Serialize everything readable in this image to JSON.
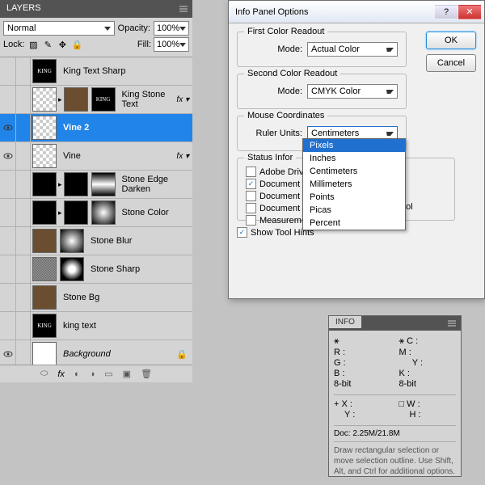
{
  "layers_panel": {
    "title": "LAYERS",
    "blend_mode": "Normal",
    "opacity_label": "Opacity:",
    "opacity_value": "100%",
    "lock_label": "Lock:",
    "fill_label": "Fill:",
    "fill_value": "100%",
    "layers": [
      {
        "name": "King Text Sharp",
        "fx": false,
        "vis": false
      },
      {
        "name": "King Stone Text",
        "fx": true,
        "vis": false
      },
      {
        "name": "Vine 2",
        "fx": false,
        "vis": true,
        "selected": true
      },
      {
        "name": "Vine",
        "fx": true,
        "vis": true
      },
      {
        "name": "Stone Edge Darken",
        "fx": false,
        "vis": false
      },
      {
        "name": "Stone Color",
        "fx": false,
        "vis": false
      },
      {
        "name": "Stone Blur",
        "fx": false,
        "vis": false
      },
      {
        "name": "Stone Sharp",
        "fx": false,
        "vis": false
      },
      {
        "name": "Stone Bg",
        "fx": false,
        "vis": false
      },
      {
        "name": "king text",
        "fx": false,
        "vis": false
      },
      {
        "name": "Background",
        "fx": false,
        "vis": true,
        "locked": true,
        "italic": true
      }
    ]
  },
  "dialog": {
    "title": "Info Panel Options",
    "ok": "OK",
    "cancel": "Cancel",
    "first_readout": "First Color Readout",
    "second_readout": "Second Color Readout",
    "mode_label": "Mode:",
    "first_mode": "Actual Color",
    "second_mode": "CMYK Color",
    "mouse_coords": "Mouse Coordinates",
    "ruler_label": "Ruler Units:",
    "ruler_value": "Centimeters",
    "ruler_options": [
      "Pixels",
      "Inches",
      "Centimeters",
      "Millimeters",
      "Points",
      "Picas",
      "Percent"
    ],
    "status_title": "Status Information",
    "status_items": [
      {
        "label": "Adobe Drive",
        "checked": false
      },
      {
        "label": "Document",
        "checked": true
      },
      {
        "label": "Document",
        "checked": false
      },
      {
        "label": "Document Dimensions",
        "checked": false
      },
      {
        "label": "Measurement Scale",
        "checked": false
      }
    ],
    "current_tool": "Current Tool",
    "show_hints": "Show Tool Hints"
  },
  "info_panel": {
    "title": "INFO",
    "r": "R :",
    "g": "G :",
    "b": "B :",
    "c": "C :",
    "m": "M :",
    "y": "Y :",
    "k": "K :",
    "bit": "8-bit",
    "x": "X :",
    "y_coord": "Y :",
    "w": "W :",
    "h": "H :",
    "doc": "Doc: 2.25M/21.8M",
    "hint": "Draw rectangular selection or move selection outline.  Use Shift, Alt, and Ctrl for additional options."
  }
}
